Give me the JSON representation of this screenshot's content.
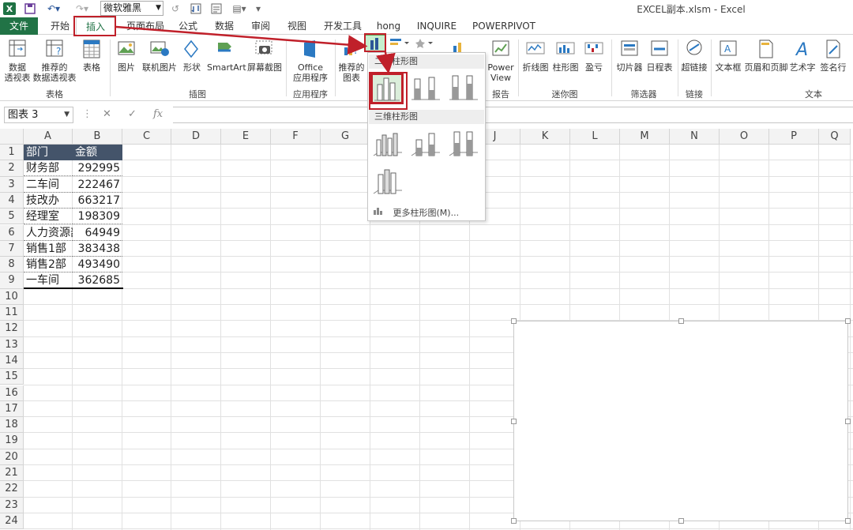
{
  "quick_access": {
    "font_name": "微软雅黑"
  },
  "window_title": "EXCEL副本.xlsm - Excel",
  "tabs": [
    {
      "label": "文件"
    },
    {
      "label": "开始"
    },
    {
      "label": "插入"
    },
    {
      "label": "页面布局"
    },
    {
      "label": "公式"
    },
    {
      "label": "数据"
    },
    {
      "label": "审阅"
    },
    {
      "label": "视图"
    },
    {
      "label": "开发工具"
    },
    {
      "label": "hong"
    },
    {
      "label": "INQUIRE"
    },
    {
      "label": "POWERPIVOT"
    }
  ],
  "ribbon": {
    "groups": {
      "tables": "表格",
      "illustrations": "插图",
      "apps": "应用程序",
      "reports": "报告",
      "sparklines": "迷你图",
      "filters": "筛选器",
      "links": "链接",
      "text": "文本"
    },
    "buttons": {
      "pivot_1": "数据",
      "pivot_2": "透视表",
      "rec_pivot_1": "推荐的",
      "rec_pivot_2": "数据透视表",
      "table": "表格",
      "picture": "图片",
      "online_picture": "联机图片",
      "shapes": "形状",
      "smartart": "SmartArt",
      "screenshot": "屏幕截图",
      "office_1": "Office",
      "office_2": "应用程序",
      "rec_charts_1": "推荐的",
      "rec_charts_2": "图表",
      "power_view_1": "Power",
      "power_view_2": "View",
      "spark_line": "折线图",
      "spark_column": "柱形图",
      "spark_winloss": "盈亏",
      "slicer": "切片器",
      "timeline": "日程表",
      "hyperlink": "超链接",
      "textbox": "文本框",
      "header_footer": "页眉和页脚",
      "wordart": "艺术字",
      "signature": "签名行"
    }
  },
  "name_box": "图表 3",
  "columns": [
    "A",
    "B",
    "C",
    "D",
    "E",
    "F",
    "G",
    "H",
    "I",
    "J",
    "K",
    "L",
    "M",
    "N",
    "O",
    "P",
    "Q"
  ],
  "rows": [
    "1",
    "2",
    "3",
    "4",
    "5",
    "6",
    "7",
    "8",
    "9",
    "10",
    "11",
    "12",
    "13",
    "14",
    "15",
    "16",
    "17",
    "18",
    "19",
    "20",
    "21",
    "22",
    "23",
    "24"
  ],
  "table": {
    "headers": [
      "部门",
      "金额"
    ],
    "rows": [
      [
        "财务部",
        "292995"
      ],
      [
        "二车间",
        "222467"
      ],
      [
        "技改办",
        "663217"
      ],
      [
        "经理室",
        "198309"
      ],
      [
        "人力资源部",
        "64949"
      ],
      [
        "销售1部",
        "383438"
      ],
      [
        "销售2部",
        "493490"
      ],
      [
        "一车间",
        "362685"
      ]
    ]
  },
  "dropdown": {
    "section_2d": "二维柱形图",
    "section_3d": "三维柱形图",
    "more": "更多柱形图(M)..."
  },
  "colors": {
    "excel_green": "#217346",
    "header_fill": "#44546a",
    "annotation_red": "#c0202a"
  }
}
